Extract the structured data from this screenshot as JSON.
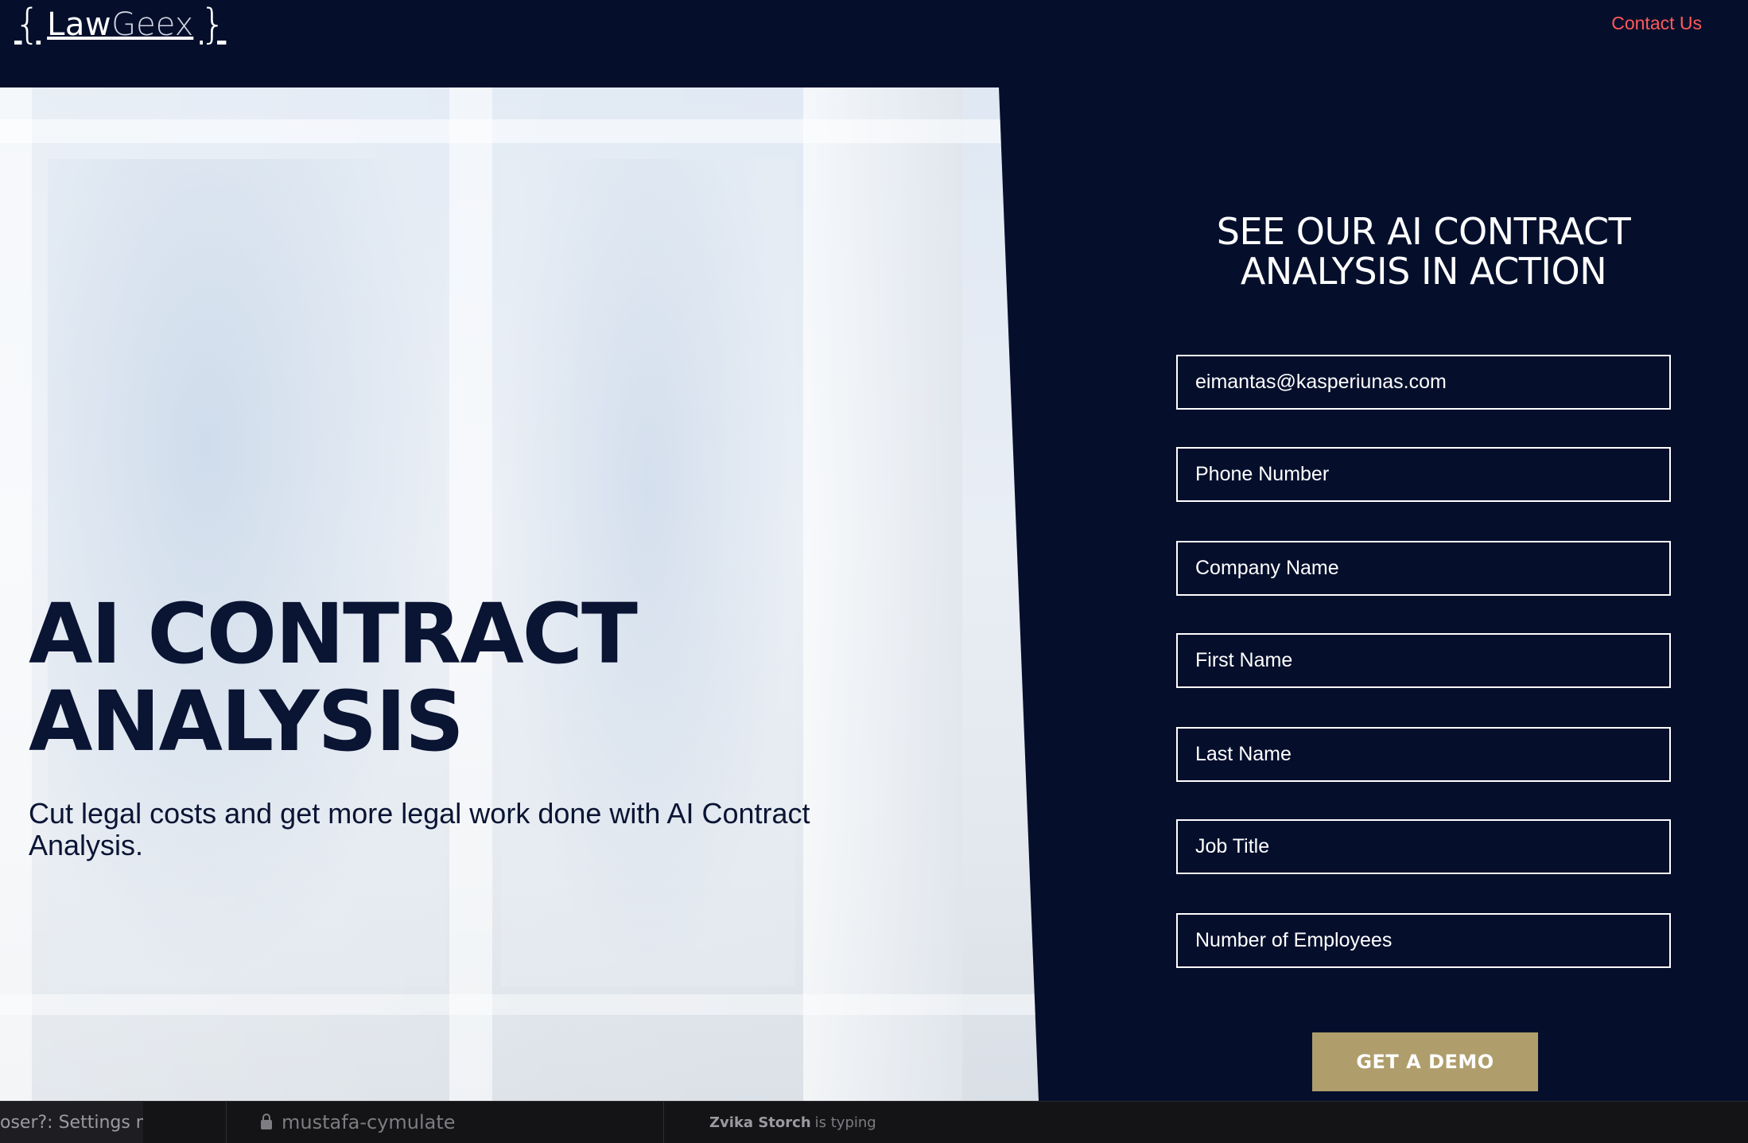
{
  "header": {
    "logo": {
      "brace_open": "{",
      "law": "Law",
      "geex": "Geex",
      "brace_close": "}"
    },
    "contact_label": "Contact Us"
  },
  "hero": {
    "title_line1": "AI CONTRACT",
    "title_line2": "ANALYSIS",
    "subtitle": "Cut legal costs and get more legal work done with AI Contract Analysis."
  },
  "form": {
    "title_line1": "SEE OUR AI CONTRACT",
    "title_line2": "ANALYSIS IN ACTION",
    "fields": [
      {
        "name": "email-field",
        "value": "eimantas@kasperiunas.com",
        "placeholder": ""
      },
      {
        "name": "phone-field",
        "value": "",
        "placeholder": "Phone Number"
      },
      {
        "name": "company-field",
        "value": "",
        "placeholder": "Company Name"
      },
      {
        "name": "first-name-field",
        "value": "",
        "placeholder": "First Name"
      },
      {
        "name": "last-name-field",
        "value": "",
        "placeholder": "Last Name"
      },
      {
        "name": "job-title-field",
        "value": "",
        "placeholder": "Job Title"
      },
      {
        "name": "employees-field",
        "value": "",
        "placeholder": "Number of Employees"
      }
    ],
    "submit_label": "GET A DEMO"
  },
  "taskbar": {
    "item1": "oser?: Settings m",
    "item2_icon": "lock-icon",
    "item2": "mustafa-cymulate",
    "typing_name": "Zvika Storch",
    "typing_suffix": "is typing"
  },
  "colors": {
    "navy": "#050f2c",
    "accent_contact": "#ff5a5a",
    "cta_gold": "#af9e6c",
    "hero_text": "#0a1433"
  }
}
